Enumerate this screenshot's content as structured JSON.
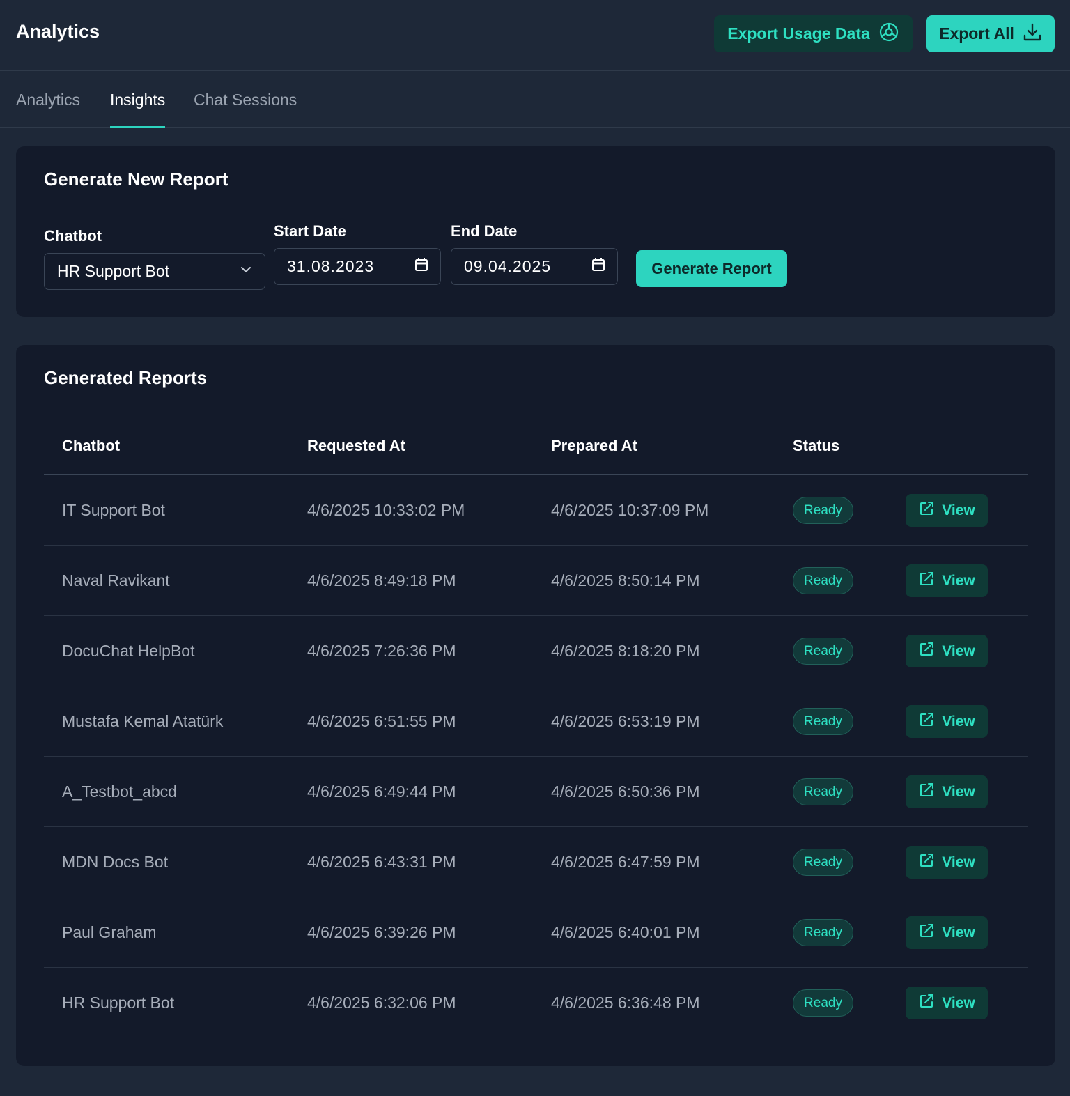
{
  "header": {
    "title": "Analytics",
    "export_usage_label": "Export Usage Data",
    "export_all_label": "Export All"
  },
  "tabs": [
    {
      "label": "Analytics",
      "active": false
    },
    {
      "label": "Insights",
      "active": true
    },
    {
      "label": "Chat Sessions",
      "active": false
    }
  ],
  "generate": {
    "title": "Generate New Report",
    "chatbot_label": "Chatbot",
    "chatbot_value": "HR Support Bot",
    "start_label": "Start Date",
    "start_value": "31.08.2023",
    "end_label": "End Date",
    "end_value": "09.04.2025",
    "button_label": "Generate Report"
  },
  "reports": {
    "title": "Generated Reports",
    "columns": [
      "Chatbot",
      "Requested At",
      "Prepared At",
      "Status"
    ],
    "view_label": "View",
    "rows": [
      {
        "chatbot": "IT Support Bot",
        "requested": "4/6/2025 10:33:02 PM",
        "prepared": "4/6/2025 10:37:09 PM",
        "status": "Ready"
      },
      {
        "chatbot": "Naval Ravikant",
        "requested": "4/6/2025 8:49:18 PM",
        "prepared": "4/6/2025 8:50:14 PM",
        "status": "Ready"
      },
      {
        "chatbot": "DocuChat HelpBot",
        "requested": "4/6/2025 7:26:36 PM",
        "prepared": "4/6/2025 8:18:20 PM",
        "status": "Ready"
      },
      {
        "chatbot": "Mustafa Kemal Atatürk",
        "requested": "4/6/2025 6:51:55 PM",
        "prepared": "4/6/2025 6:53:19 PM",
        "status": "Ready"
      },
      {
        "chatbot": "A_Testbot_abcd",
        "requested": "4/6/2025 6:49:44 PM",
        "prepared": "4/6/2025 6:50:36 PM",
        "status": "Ready"
      },
      {
        "chatbot": "MDN Docs Bot",
        "requested": "4/6/2025 6:43:31 PM",
        "prepared": "4/6/2025 6:47:59 PM",
        "status": "Ready"
      },
      {
        "chatbot": "Paul Graham",
        "requested": "4/6/2025 6:39:26 PM",
        "prepared": "4/6/2025 6:40:01 PM",
        "status": "Ready"
      },
      {
        "chatbot": "HR Support Bot",
        "requested": "4/6/2025 6:32:06 PM",
        "prepared": "4/6/2025 6:36:48 PM",
        "status": "Ready"
      }
    ]
  },
  "colors": {
    "accent": "#2dd4bf",
    "background": "#1e2838",
    "card": "#131a2a"
  },
  "icons": {
    "export_usage": "chart-pie-icon",
    "export_all": "download-icon",
    "chatbot_select": "chevron-down-icon",
    "date": "calendar-icon",
    "view": "external-link-icon"
  }
}
